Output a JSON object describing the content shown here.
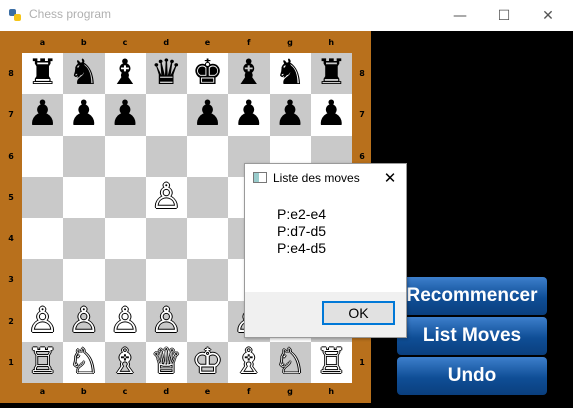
{
  "window": {
    "title": "Chess program",
    "minimize_icon": "—",
    "maximize_icon": "☐",
    "close_icon": "✕"
  },
  "board": {
    "files": [
      "a",
      "b",
      "c",
      "d",
      "e",
      "f",
      "g",
      "h"
    ],
    "ranks": [
      "8",
      "7",
      "6",
      "5",
      "4",
      "3",
      "2",
      "1"
    ],
    "colors": {
      "frame": "#b8701c",
      "light": "#ffffff",
      "dark": "#c9c9c9"
    },
    "position": [
      [
        "♜",
        "♞",
        "♝",
        "♛",
        "♚",
        "♝",
        "♞",
        "♜"
      ],
      [
        "♟",
        "♟",
        "♟",
        "",
        "♟",
        "♟",
        "♟",
        "♟"
      ],
      [
        "",
        "",
        "",
        "",
        "",
        "",
        "",
        ""
      ],
      [
        "",
        "",
        "",
        "♙",
        "",
        "",
        "",
        ""
      ],
      [
        "",
        "",
        "",
        "",
        "",
        "",
        "",
        ""
      ],
      [
        "",
        "",
        "",
        "",
        "",
        "",
        "",
        ""
      ],
      [
        "♙",
        "♙",
        "♙",
        "♙",
        "",
        "♙",
        "♙",
        "♙"
      ],
      [
        "♖",
        "♘",
        "♗",
        "♕",
        "♔",
        "♗",
        "♘",
        "♖"
      ]
    ]
  },
  "buttons": {
    "restart": "Recommencer",
    "list_moves": "List Moves",
    "undo": "Undo"
  },
  "dialog": {
    "title": "Liste des moves",
    "close_icon": "✕",
    "moves": [
      "P:e2-e4",
      "P:d7-d5",
      "P:e4-d5"
    ],
    "ok_label": "OK"
  }
}
